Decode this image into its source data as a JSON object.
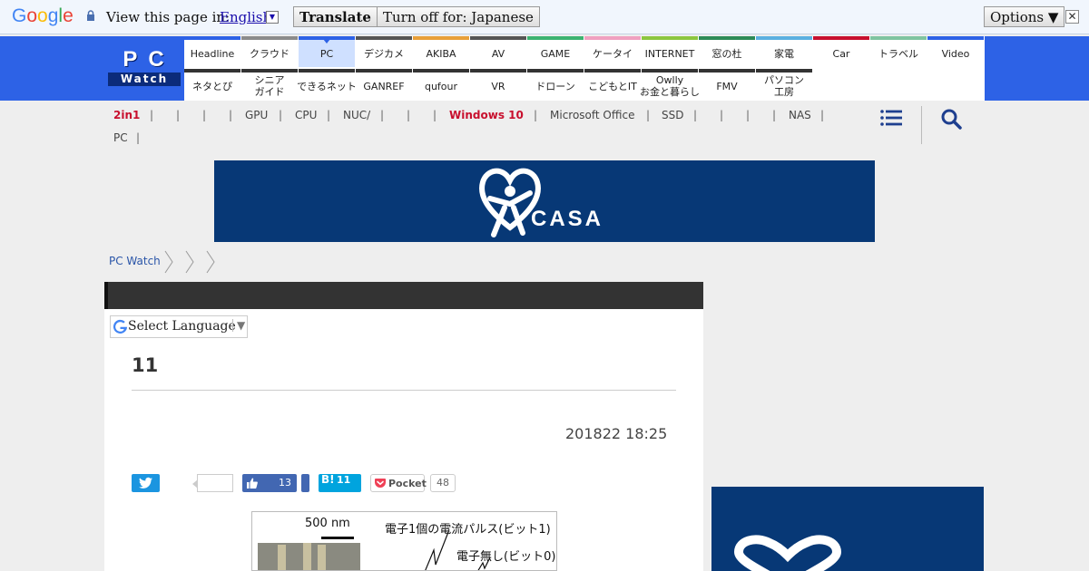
{
  "translate_bar": {
    "logo": "Google",
    "view_label": "View this page in:",
    "language": "English",
    "translate_button": "Translate",
    "turn_off_button": "Turn off for: Japanese",
    "options_button": "Options ▼",
    "close": "✕"
  },
  "site": {
    "logo_top": "PC",
    "logo_bottom": "Watch"
  },
  "nav": {
    "row1": [
      {
        "label": "Headline",
        "color": "#2d62e6"
      },
      {
        "label": "クラウド",
        "color": "#8b8b8b"
      },
      {
        "label": "PC",
        "color": "#2d62e6",
        "active": true
      },
      {
        "label": "デジカメ",
        "color": "#555555"
      },
      {
        "label": "AKIBA",
        "color": "#e8a03a"
      },
      {
        "label": "AV",
        "color": "#555555"
      },
      {
        "label": "GAME",
        "color": "#3cb371"
      },
      {
        "label": "ケータイ",
        "color": "#f0a0c0"
      },
      {
        "label": "INTERNET",
        "color": "#8cc63f"
      },
      {
        "label": "窓の杜",
        "color": "#2e8b57"
      },
      {
        "label": "家電",
        "color": "#5bb0e0"
      },
      {
        "label": "Car",
        "color": "#c8102e"
      },
      {
        "label": "トラベル",
        "color": "#7fc4a0"
      },
      {
        "label": "Video",
        "color": "#2d62e6"
      }
    ],
    "row2": [
      {
        "label": "ネタとぴ"
      },
      {
        "label": "シニア\nガイド"
      },
      {
        "label": "できるネット"
      },
      {
        "label": "GANREF"
      },
      {
        "label": "qufour"
      },
      {
        "label": "VR"
      },
      {
        "label": "ドローン"
      },
      {
        "label": "こどもとIT"
      },
      {
        "label": "Owlly\nお金と暮らし"
      },
      {
        "label": "FMV"
      },
      {
        "label": "パソコン\n工房"
      }
    ]
  },
  "keywords": {
    "row1": [
      "2in1",
      "",
      "",
      "",
      "",
      "GPU",
      "CPU",
      "NUC/",
      "",
      "",
      "Windows 10",
      "Microsoft Office",
      "SSD",
      "",
      "",
      "",
      "NAS"
    ],
    "row2": [
      "PC"
    ]
  },
  "ad_banner": {
    "text": "CASA"
  },
  "breadcrumb": {
    "home": "PC Watch"
  },
  "translate_widget": {
    "label": "Select Language",
    "arrow": "▼"
  },
  "article": {
    "title": "11",
    "date": "201822 18:25"
  },
  "social": {
    "fb_count": "13",
    "hatena_label": "B!",
    "hatena_count": "11",
    "pocket_label": "Pocket",
    "pocket_count": "48"
  },
  "figure": {
    "scale": "500 nm",
    "label1": "電子1個の電流パルス(ビット1)",
    "label2": "電子無し(ビット0)"
  },
  "colors": {
    "header_blue": "#2d62e6",
    "ad_navy": "#073876",
    "hot_keyword": "#c8102e"
  }
}
